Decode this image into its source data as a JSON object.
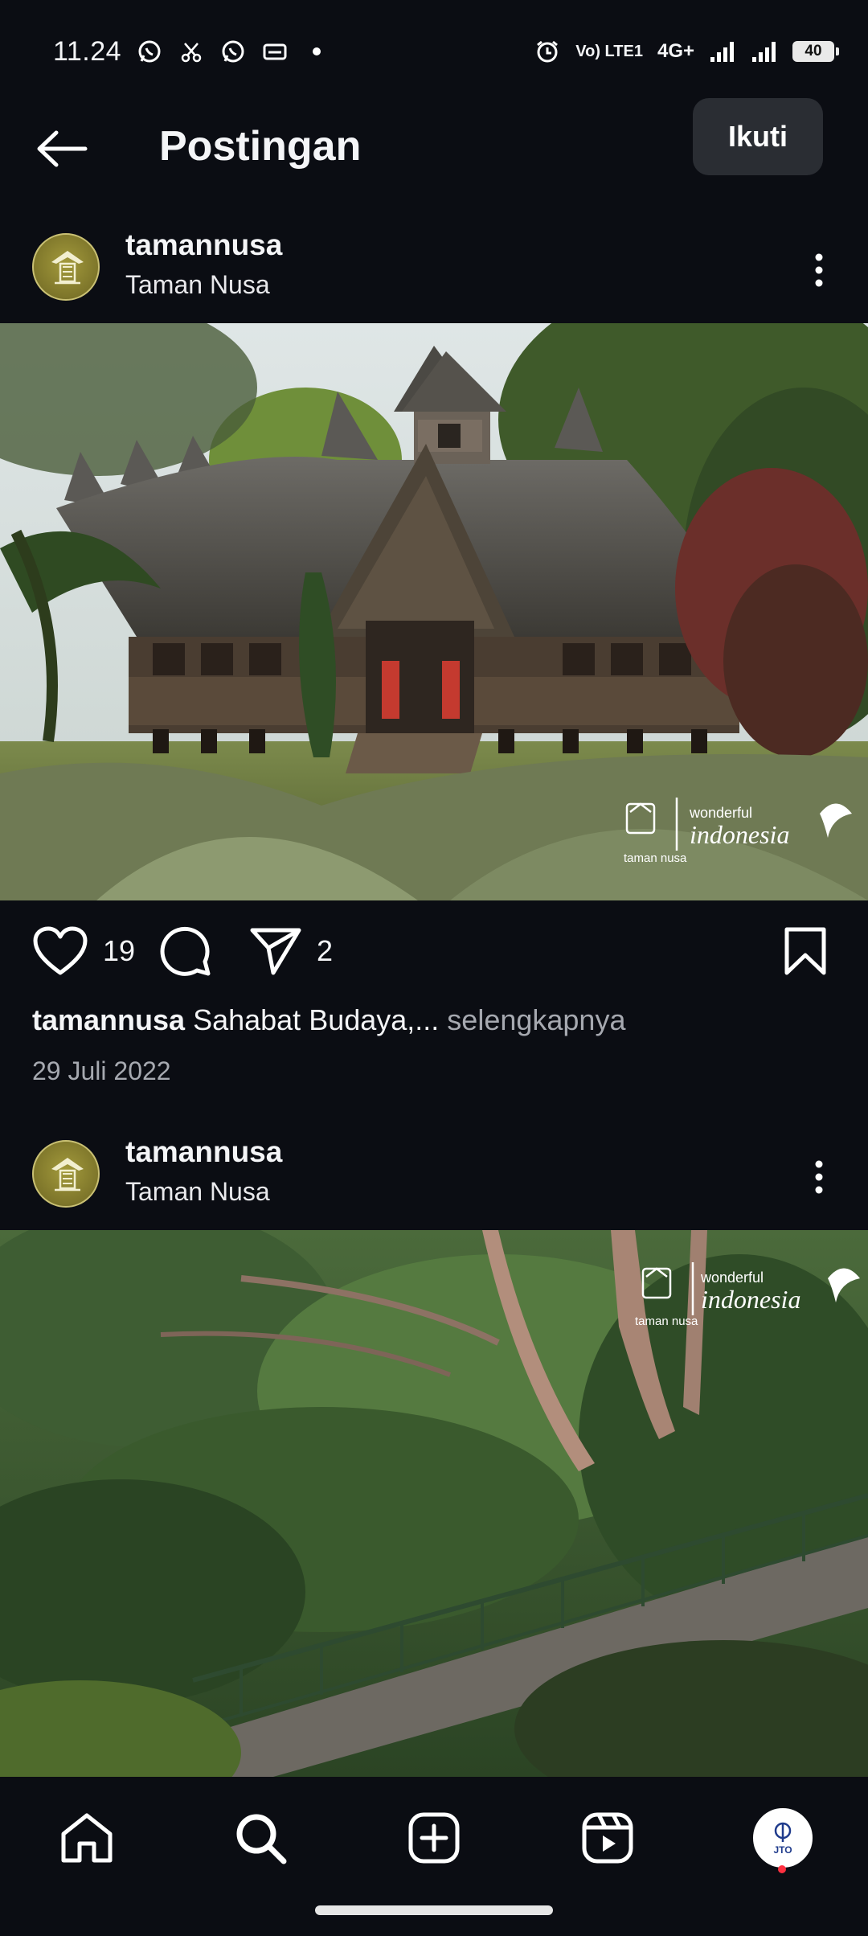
{
  "status_bar": {
    "time": "11.24",
    "network_label": "Vo) LTE1",
    "network_type": "4G+",
    "battery": "40",
    "icons": [
      "whatsapp-icon",
      "cut-icon",
      "whatsapp-icon",
      "card-icon",
      "dot-icon",
      "alarm-icon",
      "signal-icon",
      "signal-icon"
    ]
  },
  "header": {
    "title": "Postingan",
    "follow_label": "Ikuti"
  },
  "posts": [
    {
      "username": "tamannusa",
      "location": "Taman Nusa",
      "likes": "19",
      "shares": "2",
      "caption_user": "tamannusa",
      "caption_text": " Sahabat Budaya,...",
      "caption_more": " selengkapnya",
      "date": "29 Juli 2022",
      "watermark_brand": "taman nusa",
      "watermark_text_small": "wonderful",
      "watermark_text_big": "indonesia"
    },
    {
      "username": "tamannusa",
      "location": "Taman Nusa",
      "watermark_brand": "taman nusa",
      "watermark_text_small": "wonderful",
      "watermark_text_big": "indonesia"
    }
  ],
  "bottom_nav": {
    "items": [
      "home-icon",
      "search-icon",
      "add-icon",
      "reels-icon",
      "profile-avatar"
    ],
    "profile_initials": "JTO"
  },
  "colors": {
    "background": "#0b0d13",
    "button_bg": "#2a2d33",
    "muted_text": "#a6a9b0",
    "notification_dot": "#ff3040"
  }
}
